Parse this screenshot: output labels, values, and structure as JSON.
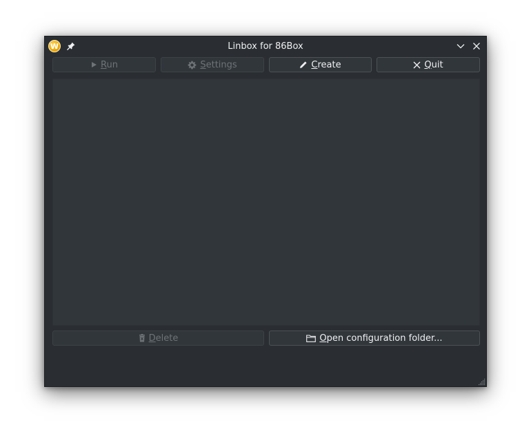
{
  "window": {
    "title": "Linbox for 86Box",
    "app_icon_letter": "W"
  },
  "toolbar": {
    "run": {
      "prefix": "",
      "mnemonic": "R",
      "rest": "un",
      "enabled": false
    },
    "settings": {
      "prefix": "",
      "mnemonic": "S",
      "rest": "ettings",
      "enabled": false
    },
    "create": {
      "prefix": "",
      "mnemonic": "C",
      "rest": "reate",
      "enabled": true
    },
    "quit": {
      "prefix": "",
      "mnemonic": "Q",
      "rest": "uit",
      "enabled": true
    }
  },
  "bottom": {
    "delete": {
      "mnemonic": "D",
      "rest": "elete",
      "enabled": false
    },
    "open_folder": {
      "mnemonic": "O",
      "rest": "pen configuration folder...",
      "enabled": true
    }
  },
  "icons": {
    "app": "86box-app-icon",
    "pin": "pin-icon",
    "minimize": "chevron-down-icon",
    "close": "close-icon",
    "run": "play-icon",
    "settings": "gear-icon",
    "create": "pencil-icon",
    "quit": "x-icon",
    "delete": "trash-icon",
    "folder": "folder-icon"
  },
  "colors": {
    "window_bg": "#2a2e32",
    "panel_bg": "#31363b",
    "text": "#eff0f1",
    "disabled_text": "#6e7378",
    "accent": "#f0a800"
  }
}
